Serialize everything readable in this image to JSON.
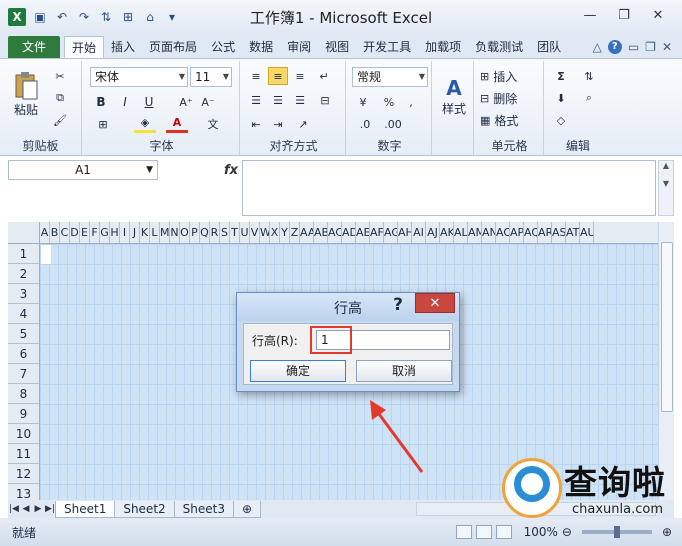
{
  "window": {
    "title": "工作簿1 - Microsoft Excel",
    "logo_letter": "X"
  },
  "ribbon_tabs": [
    "文件",
    "开始",
    "插入",
    "页面布局",
    "公式",
    "数据",
    "审阅",
    "视图",
    "开发工具",
    "加载项",
    "负载测试",
    "团队"
  ],
  "clipboard": {
    "paste": "粘贴",
    "label": "剪贴板"
  },
  "font": {
    "name": "宋体",
    "size": "11",
    "label": "字体",
    "bold": "B",
    "italic": "I",
    "underline": "U"
  },
  "alignment": {
    "label": "对齐方式"
  },
  "number": {
    "format": "常规",
    "label": "数字",
    "percent": "%"
  },
  "styles": {
    "label": "样式"
  },
  "cells": {
    "insert": "插入",
    "delete": "删除",
    "format": "格式",
    "label": "单元格"
  },
  "editing": {
    "label": "编辑"
  },
  "formula_bar": {
    "name_box": "A1",
    "fx": "fx"
  },
  "columns": [
    "A",
    "B",
    "C",
    "D",
    "E",
    "F",
    "G",
    "H",
    "I",
    "J",
    "K",
    "L",
    "M",
    "N",
    "O",
    "P",
    "Q",
    "R",
    "S",
    "T",
    "U",
    "V",
    "W",
    "X",
    "Y",
    "Z",
    "AA",
    "AB",
    "AC",
    "AD",
    "AE",
    "AF",
    "AG",
    "AH",
    "AI",
    "AJ",
    "AK",
    "AL",
    "AM",
    "AN",
    "AO",
    "AP",
    "AQ",
    "AR",
    "AS",
    "AT",
    "AU"
  ],
  "rows": [
    "1",
    "2",
    "3",
    "4",
    "5",
    "6",
    "7",
    "8",
    "9",
    "10",
    "11",
    "12",
    "13"
  ],
  "sheets": [
    "Sheet1",
    "Sheet2",
    "Sheet3"
  ],
  "status": {
    "ready": "就绪",
    "zoom": "100%"
  },
  "dialog": {
    "title": "行高",
    "help": "?",
    "close": "✕",
    "label": "行高(R):",
    "value": "1",
    "ok": "确定",
    "cancel": "取消"
  },
  "watermark": {
    "text": "查询啦",
    "url": "chaxunla.com"
  }
}
